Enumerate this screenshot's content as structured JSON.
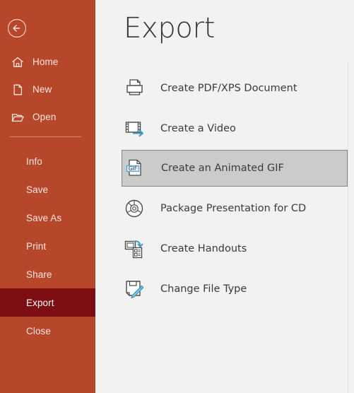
{
  "theme": {
    "sidebar_bg": "#b7472a",
    "sidebar_selected_bg": "#7d0f14",
    "main_bg": "#f2f2f2",
    "selected_item_bg": "#cbcbcb",
    "selected_item_border": "#868686",
    "accent_blue": "#41a0c8",
    "text_dark": "#3b3b3b",
    "sidebar_text": "#f6e6e2"
  },
  "sidebar": {
    "back_button": {
      "name": "back-arrow-icon",
      "label": "Back"
    },
    "top_items": [
      {
        "label": "Home",
        "icon": "home-icon"
      },
      {
        "label": "New",
        "icon": "new-document-icon"
      },
      {
        "label": "Open",
        "icon": "open-folder-icon"
      }
    ],
    "bottom_items": [
      {
        "label": "Info",
        "selected": false
      },
      {
        "label": "Save",
        "selected": false
      },
      {
        "label": "Save As",
        "selected": false
      },
      {
        "label": "Print",
        "selected": false
      },
      {
        "label": "Share",
        "selected": false
      },
      {
        "label": "Export",
        "selected": true
      },
      {
        "label": "Close",
        "selected": false
      }
    ]
  },
  "main": {
    "title": "Export",
    "items": [
      {
        "label": "Create PDF/XPS Document",
        "icon": "printer-document-icon",
        "selected": false
      },
      {
        "label": "Create a Video",
        "icon": "film-strip-arrow-icon",
        "selected": false
      },
      {
        "label": "Create an Animated GIF",
        "icon": "gif-document-icon",
        "selected": true
      },
      {
        "label": "Package Presentation for CD",
        "icon": "cd-disc-icon",
        "selected": false
      },
      {
        "label": "Create Handouts",
        "icon": "handouts-icon",
        "selected": false
      },
      {
        "label": "Change File Type",
        "icon": "file-type-pencil-icon",
        "selected": false
      }
    ]
  }
}
